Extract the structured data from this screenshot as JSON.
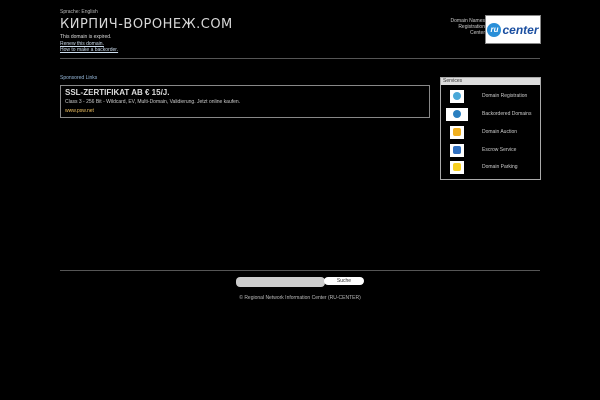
{
  "header": {
    "language": "Sprache: English",
    "title": "КИРПИЧ-ВОРОНЕЖ.COM",
    "status": "This domain is expired.",
    "renew_link": "Renew this domain.",
    "backorder_link": "How to make a backorder."
  },
  "registrar": {
    "text_lines": [
      "Domain Names",
      "Registration",
      "Center"
    ],
    "logo_ru": "ru",
    "logo_text": "center"
  },
  "sponsored": {
    "heading": "Sponsored Links",
    "ads": [
      {
        "title": "SSL-ZERTIFIKAT AB € 15/J.",
        "description": "Class 3 - 256 Bit - Wildcard, EV, Multi-Domain, Validierung. Jetzt online kaufen.",
        "url": "www.psw.net"
      }
    ]
  },
  "services": {
    "heading": "Services",
    "items": [
      {
        "label": "Domain Registration",
        "color": "#4aa8d8"
      },
      {
        "label": "Backordered Domains",
        "color": "#2a7fc0"
      },
      {
        "label": "Domain Auction",
        "color": "#f0b020"
      },
      {
        "label": "Escrow Service",
        "color": "#3070c0"
      },
      {
        "label": "Domain Parking",
        "color": "#f8d020"
      }
    ]
  },
  "footer": {
    "search_placeholder": "",
    "search_button": "Suche",
    "copyright": "© Regional Network Information Center (RU-CENTER)"
  }
}
